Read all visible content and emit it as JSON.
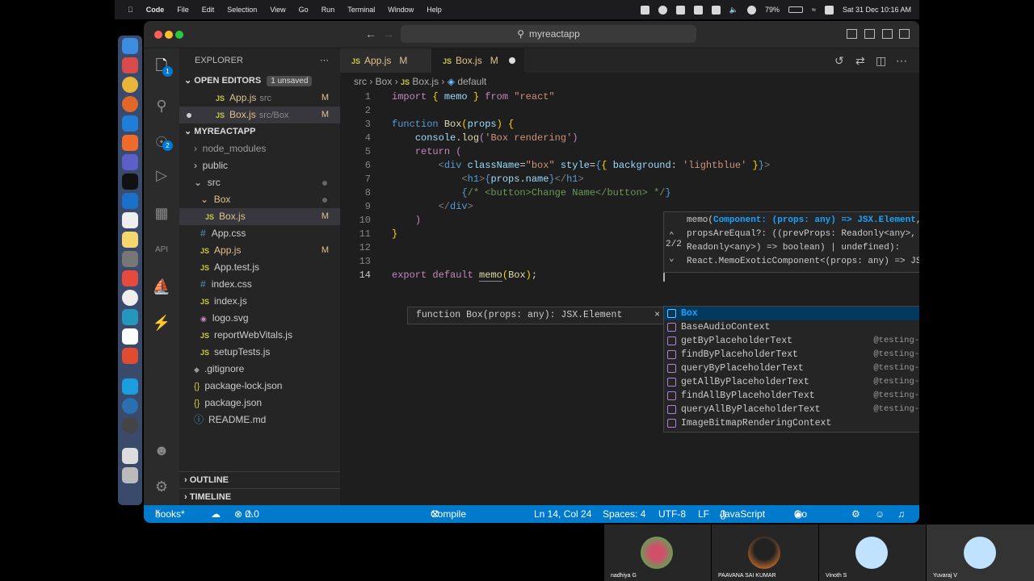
{
  "menubar": {
    "app": "Code",
    "items": [
      "File",
      "Edit",
      "Selection",
      "View",
      "Go",
      "Run",
      "Terminal",
      "Window",
      "Help"
    ],
    "battery": "79%",
    "datetime": "Sat 31 Dec  10:16 AM"
  },
  "window": {
    "search": "myreactapp"
  },
  "activity": {
    "explorer_badge": "1",
    "scm_badge": "2"
  },
  "sidebar": {
    "title": "EXPLORER",
    "open_editors": {
      "label": "OPEN EDITORS",
      "badge": "1 unsaved",
      "files": [
        {
          "name": "App.js",
          "path": "src",
          "status": "M"
        },
        {
          "name": "Box.js",
          "path": "src/Box",
          "status": "M"
        }
      ]
    },
    "project": {
      "label": "MYREACTAPP",
      "folders": {
        "node_modules": "node_modules",
        "public": "public",
        "src": "src",
        "box": "Box"
      },
      "box_file": {
        "name": "Box.js",
        "status": "M"
      },
      "src_files": [
        {
          "name": "App.css",
          "icon": "#"
        },
        {
          "name": "App.js",
          "icon": "JS",
          "status": "M"
        },
        {
          "name": "App.test.js",
          "icon": "JS"
        },
        {
          "name": "index.css",
          "icon": "#"
        },
        {
          "name": "index.js",
          "icon": "JS"
        },
        {
          "name": "logo.svg",
          "icon": "svg"
        },
        {
          "name": "reportWebVitals.js",
          "icon": "JS"
        },
        {
          "name": "setupTests.js",
          "icon": "JS"
        }
      ],
      "root_files": [
        {
          "name": ".gitignore",
          "icon": "◆"
        },
        {
          "name": "package-lock.json",
          "icon": "{}"
        },
        {
          "name": "package.json",
          "icon": "{}"
        },
        {
          "name": "README.md",
          "icon": "ⓘ"
        }
      ]
    },
    "outline": "OUTLINE",
    "timeline": "TIMELINE"
  },
  "tabs": [
    {
      "icon": "JS",
      "name": "App.js",
      "status": "M"
    },
    {
      "icon": "JS",
      "name": "Box.js",
      "status": "M"
    }
  ],
  "breadcrumb": {
    "a": "src",
    "b": "Box",
    "c": "Box.js",
    "d": "default",
    "js": "JS"
  },
  "code": {
    "line_numbers": [
      "1",
      "2",
      "3",
      "4",
      "5",
      "6",
      "7",
      "8",
      "9",
      "10",
      "11",
      "12",
      "13",
      "14"
    ]
  },
  "signature": {
    "counter": "2/2",
    "line1_pre": "memo(",
    "line1_param": "Component: (props: any) => JSX.Element",
    "line1_post": ",",
    "line2": "propsAreEqual?: ((prevProps: Readonly<any>, nextProps:",
    "line3": "Readonly<any>) => boolean) | undefined):",
    "line4": "React.MemoExoticComponent<(props: any) => JSX.Element>"
  },
  "hover": {
    "text": "function Box(props: any): JSX.Element",
    "close": "×"
  },
  "suggestions": [
    {
      "label": "Box",
      "detail": ""
    },
    {
      "label": "BaseAudioContext",
      "detail": ""
    },
    {
      "label": "getByPlaceholderText",
      "detail": "@testing-library/react"
    },
    {
      "label": "findByPlaceholderText",
      "detail": "@testing-library/react"
    },
    {
      "label": "queryByPlaceholderText",
      "detail": "@testing-library/react"
    },
    {
      "label": "getAllByPlaceholderText",
      "detail": "@testing-library/react"
    },
    {
      "label": "findAllByPlaceholderText",
      "detail": "@testing-library/react"
    },
    {
      "label": "queryAllByPlaceholderText",
      "detail": "@testing-library/react"
    },
    {
      "label": "ImageBitmapRenderingContext",
      "detail": ""
    }
  ],
  "status": {
    "branch": "hooks*",
    "errors": "0",
    "warnings": "0",
    "compile": "Compile Hero: Off",
    "position": "Ln 14, Col 24",
    "spaces": "Spaces: 4",
    "encoding": "UTF-8",
    "eol": "LF",
    "language": "JavaScript",
    "golive": "Go Live"
  },
  "participants": [
    {
      "name": "nadhiya G"
    },
    {
      "name": "PAAVANA SAI KUMAR"
    },
    {
      "name": "Vinoth S"
    },
    {
      "name": "Yuvaraj V"
    }
  ],
  "colors": {
    "statusbar": "#007acc",
    "accent": "#0078d4",
    "modified": "#e2c08d"
  }
}
